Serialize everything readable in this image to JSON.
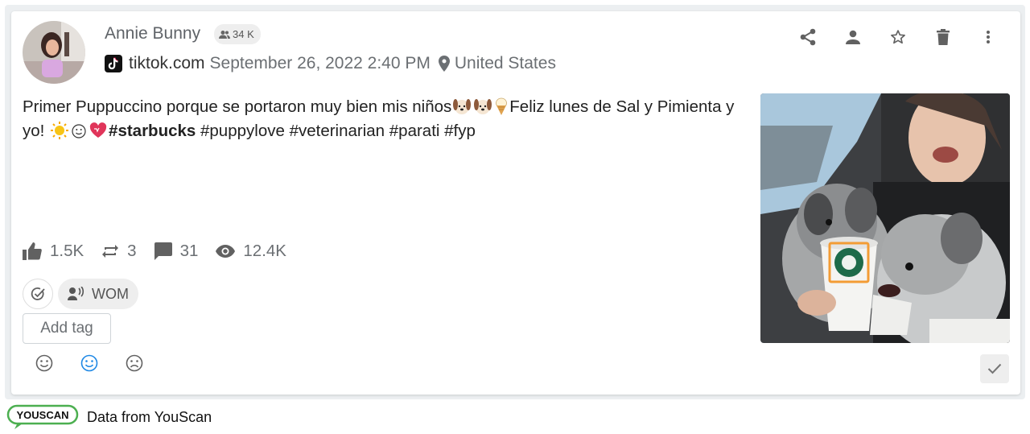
{
  "post": {
    "author": "Annie Bunny",
    "followers": "34 K",
    "site": "tiktok.com",
    "date": "September 26, 2022 2:40 PM",
    "location": "United States",
    "text_1": "Primer Puppuccino porque se portaron muy bien mis niños",
    "text_2": "Feliz lunes de Sal y Pimienta y yo! ",
    "hashtag_bold": "#starbucks",
    "hashtags_rest": " #puppylove #veterinarian #parati #fyp"
  },
  "stats": {
    "likes": "1.5K",
    "reposts": "3",
    "comments": "31",
    "views": "12.4K"
  },
  "tags": {
    "wom_label": "WOM",
    "add_tag_label": "Add tag"
  },
  "footer": {
    "logo_text": "YOUSCAN",
    "source_text": "Data from YouScan"
  },
  "colors": {
    "accent": "#1e88e5",
    "logo_green": "#4caf50",
    "highlight_box": "#f39c35"
  },
  "icons": [
    "share-icon",
    "person-icon",
    "star-icon",
    "trash-icon",
    "more-vert-icon",
    "thumb-up-icon",
    "repost-icon",
    "comment-icon",
    "eye-icon",
    "location-pin-icon",
    "tiktok-icon",
    "followers-icon",
    "check-icon"
  ]
}
